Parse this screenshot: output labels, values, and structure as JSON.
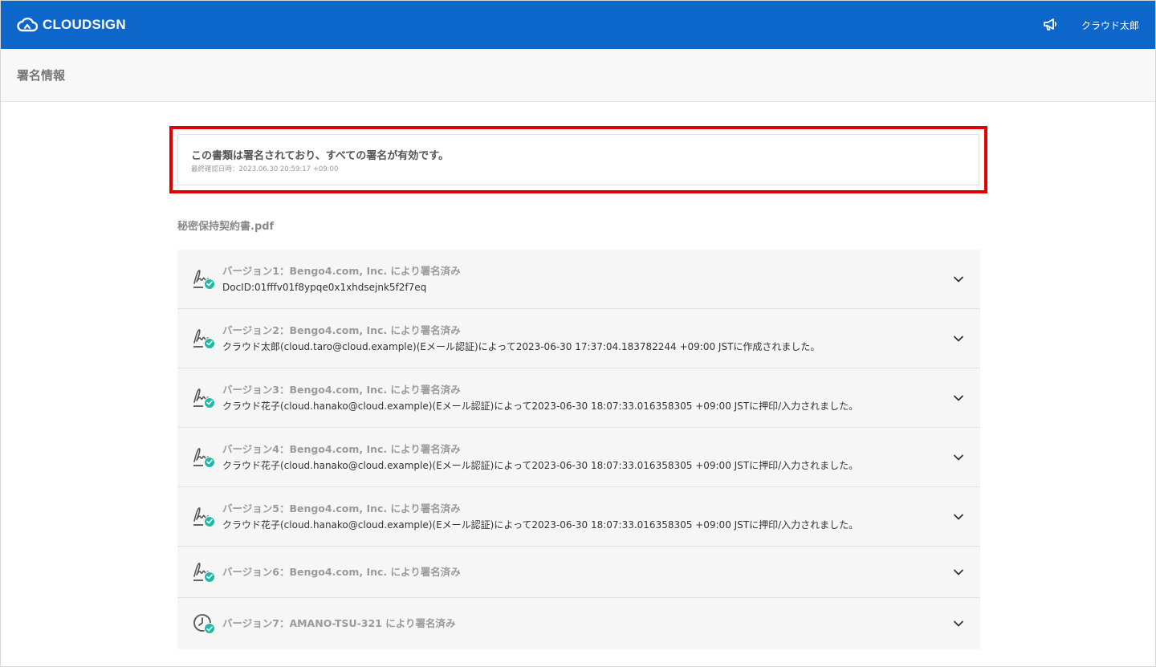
{
  "header": {
    "brand": "CLOUDSIGN",
    "user_name": "クラウド太郎"
  },
  "page": {
    "title": "署名情報"
  },
  "status": {
    "message": "この書類は署名されており、すべての署名が有効です。",
    "last_checked": "最終確認日時：2023.06.30 20:59:17 +09:00"
  },
  "document": {
    "file_name": "秘密保持契約書.pdf"
  },
  "versions": [
    {
      "title": "バージョン1：Bengo4.com, Inc. により署名済み",
      "detail": "DocID:01fffv01f8ypqe0x1xhdsejnk5f2f7eq",
      "icon": "signature-icon"
    },
    {
      "title": "バージョン2：Bengo4.com, Inc. により署名済み",
      "detail": "クラウド太郎(cloud.taro@cloud.example)(Eメール認証)によって2023-06-30 17:37:04.183782244 +09:00 JSTに作成されました。",
      "icon": "signature-icon"
    },
    {
      "title": "バージョン3：Bengo4.com, Inc. により署名済み",
      "detail": "クラウド花子(cloud.hanako@cloud.example)(Eメール認証)によって2023-06-30 18:07:33.016358305 +09:00 JSTに押印/入力されました。",
      "icon": "signature-icon"
    },
    {
      "title": "バージョン4：Bengo4.com, Inc. により署名済み",
      "detail": "クラウド花子(cloud.hanako@cloud.example)(Eメール認証)によって2023-06-30 18:07:33.016358305 +09:00 JSTに押印/入力されました。",
      "icon": "signature-icon"
    },
    {
      "title": "バージョン5：Bengo4.com, Inc. により署名済み",
      "detail": "クラウド花子(cloud.hanako@cloud.example)(Eメール認証)によって2023-06-30 18:07:33.016358305 +09:00 JSTに押印/入力されました。",
      "icon": "signature-icon"
    },
    {
      "title": "バージョン6：Bengo4.com, Inc. により署名済み",
      "detail": "",
      "icon": "signature-icon"
    },
    {
      "title": "バージョン7：AMANO-TSU-321 により署名済み",
      "detail": "",
      "icon": "timestamp-clock-icon"
    }
  ],
  "colors": {
    "header_bg": "#0d66c9",
    "highlight_border": "#e00000",
    "check_badge": "#20b9a6",
    "row_bg": "#f6f6f6"
  }
}
